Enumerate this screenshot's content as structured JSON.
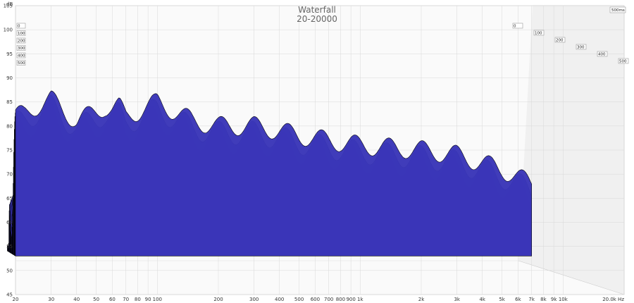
{
  "chart_data": {
    "type": "area",
    "title": "Waterfall",
    "subtitle": "20-20000",
    "ylabel": "dB",
    "xunit": "Hz",
    "ylim": [
      45,
      105
    ],
    "xlim": [
      20,
      20000
    ],
    "xscale": "log",
    "grid": true,
    "fill_color": "#3a36b8",
    "line_color": "#000000",
    "y_ticks": [
      105,
      100,
      95,
      90,
      85,
      80,
      75,
      70,
      65,
      60,
      55,
      50,
      45
    ],
    "x_ticks": [
      {
        "v": 20,
        "label": "20"
      },
      {
        "v": 30,
        "label": "30"
      },
      {
        "v": 40,
        "label": "40"
      },
      {
        "v": 50,
        "label": "50"
      },
      {
        "v": 60,
        "label": "60"
      },
      {
        "v": 70,
        "label": "70"
      },
      {
        "v": 80,
        "label": "80"
      },
      {
        "v": 90,
        "label": "90"
      },
      {
        "v": 100,
        "label": "100"
      },
      {
        "v": 200,
        "label": "200"
      },
      {
        "v": 300,
        "label": "300"
      },
      {
        "v": 400,
        "label": "400"
      },
      {
        "v": 500,
        "label": "500"
      },
      {
        "v": 600,
        "label": "600"
      },
      {
        "v": 700,
        "label": "700"
      },
      {
        "v": 800,
        "label": "800"
      },
      {
        "v": 900,
        "label": "900"
      },
      {
        "v": 1000,
        "label": "1k"
      },
      {
        "v": 2000,
        "label": "2k"
      },
      {
        "v": 3000,
        "label": "3k"
      },
      {
        "v": 4000,
        "label": "4k"
      },
      {
        "v": 5000,
        "label": "5k"
      },
      {
        "v": 6000,
        "label": "6k"
      },
      {
        "v": 7000,
        "label": "7k"
      },
      {
        "v": 8000,
        "label": "8k"
      },
      {
        "v": 9000,
        "label": "9k"
      },
      {
        "v": 10000,
        "label": "10k"
      },
      {
        "v": 20000,
        "label": "20.0k Hz"
      }
    ],
    "time_ticks_ms": [
      {
        "v": 0,
        "label": "0"
      },
      {
        "v": 100,
        "label": "100"
      },
      {
        "v": 200,
        "label": "200"
      },
      {
        "v": 300,
        "label": "300"
      },
      {
        "v": 400,
        "label": "400"
      },
      {
        "v": 500,
        "label": "500"
      }
    ],
    "time_axis_end_label": "500ms",
    "envelope": {
      "x": [
        20,
        22,
        25,
        28,
        30,
        35,
        40,
        45,
        50,
        55,
        60,
        65,
        70,
        80,
        90,
        100,
        150,
        200,
        300,
        400,
        500,
        700,
        1000,
        2000,
        3000,
        5000,
        7000
      ],
      "y": [
        84,
        84.5,
        86,
        87,
        87.5,
        85,
        83,
        84,
        85,
        86,
        85.5,
        86,
        84,
        85,
        86,
        87,
        83,
        82,
        82,
        81,
        80,
        79,
        78,
        77,
        76,
        73,
        70
      ]
    }
  }
}
